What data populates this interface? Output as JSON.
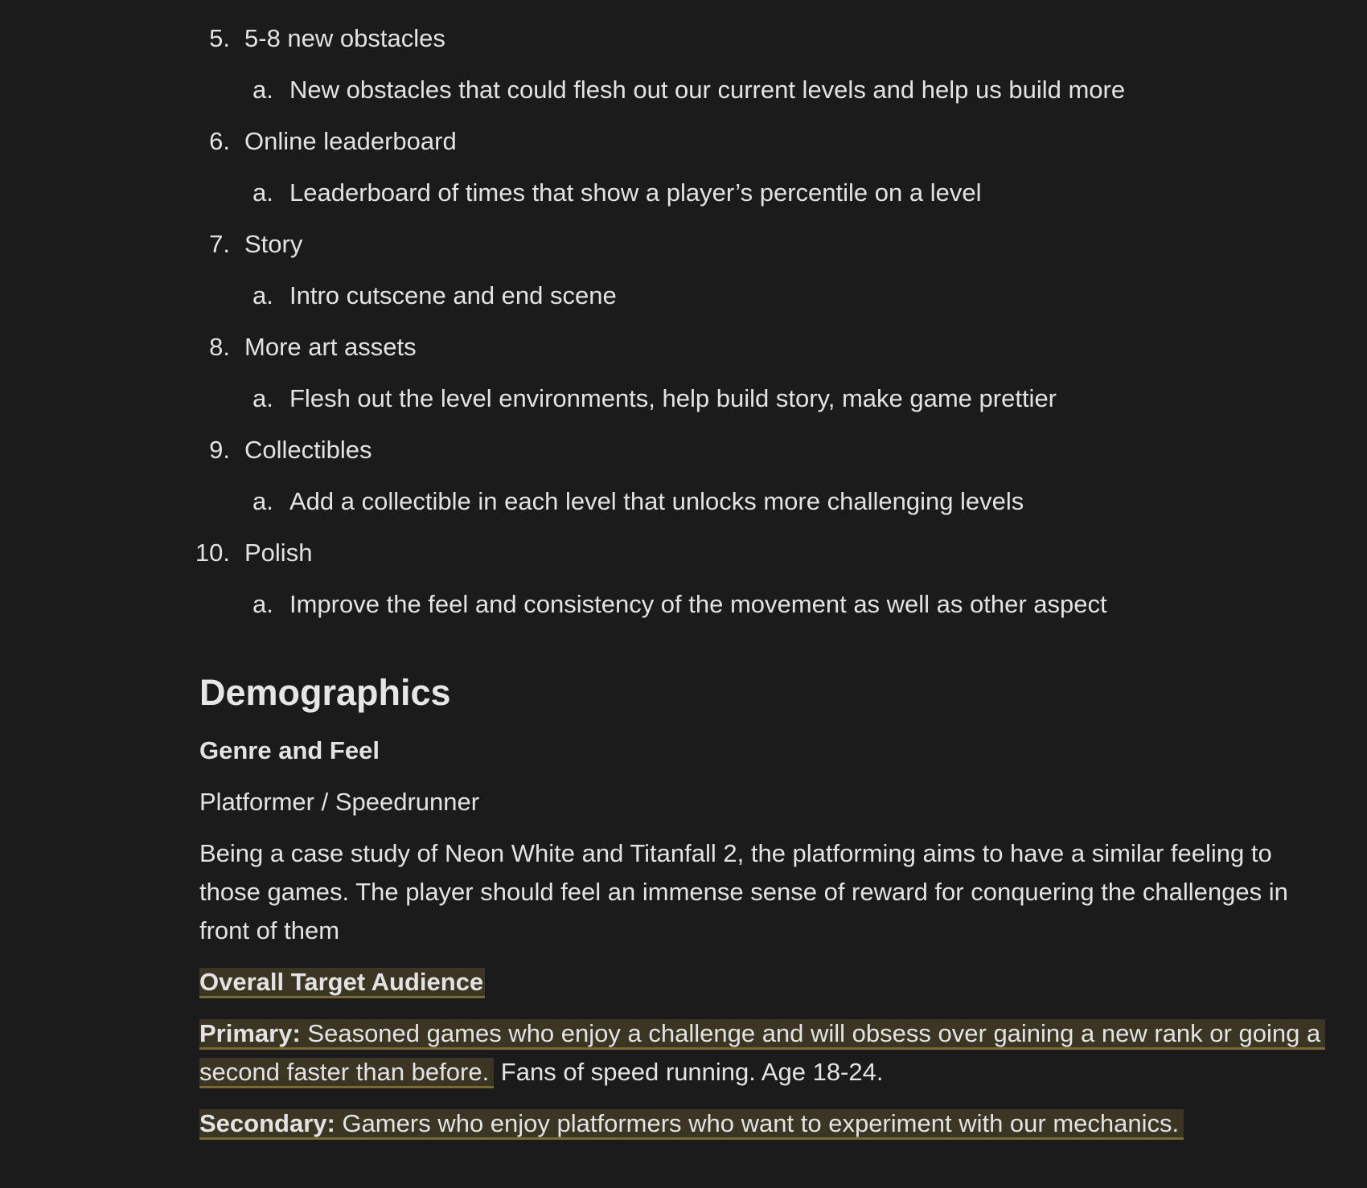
{
  "list": [
    {
      "num": "5.",
      "label": "5-8 new obstacles",
      "sub": {
        "letter": "a.",
        "label": "New obstacles that could flesh out our current levels and help us build more"
      }
    },
    {
      "num": "6.",
      "label": "Online leaderboard",
      "sub": {
        "letter": "a.",
        "label": "Leaderboard of times that show a player’s percentile on a level"
      }
    },
    {
      "num": "7.",
      "label": "Story",
      "sub": {
        "letter": "a.",
        "label": "Intro cutscene and end scene"
      }
    },
    {
      "num": "8.",
      "label": "More art assets",
      "sub": {
        "letter": "a.",
        "label": "Flesh out the level environments, help build story, make game prettier"
      }
    },
    {
      "num": "9.",
      "label": "Collectibles",
      "sub": {
        "letter": "a.",
        "label": "Add a collectible in each level that unlocks more challenging levels"
      }
    },
    {
      "num": "10.",
      "label": "Polish",
      "sub": {
        "letter": "a.",
        "label": "Improve the feel and consistency of the movement as well as other aspect"
      }
    }
  ],
  "demographics": {
    "heading": "Demographics",
    "genre_heading": "Genre and Feel",
    "genre": "Platformer / Speedrunner",
    "description": "Being a case study of Neon White and Titanfall 2, the platforming aims to have a similar feeling to those games. The player should feel an immense sense of reward for conquering the challenges in front of them",
    "audience_heading": "Overall Target Audience",
    "primary_label": "Primary:",
    "primary_highlight": " Seasoned games who enjoy a challenge and will obsess over gaining a new rank or going a second faster than before.",
    "primary_rest": " Fans of speed running. Age 18-24.",
    "secondary_label": "Secondary:",
    "secondary_text": " Gamers who enjoy platformers who want to experiment with our mechanics. "
  },
  "colors": {
    "background": "#1b1b1b",
    "text": "#e3e3e3",
    "highlight": "#3b3524",
    "highlight_underline": "#7a6a3a"
  }
}
